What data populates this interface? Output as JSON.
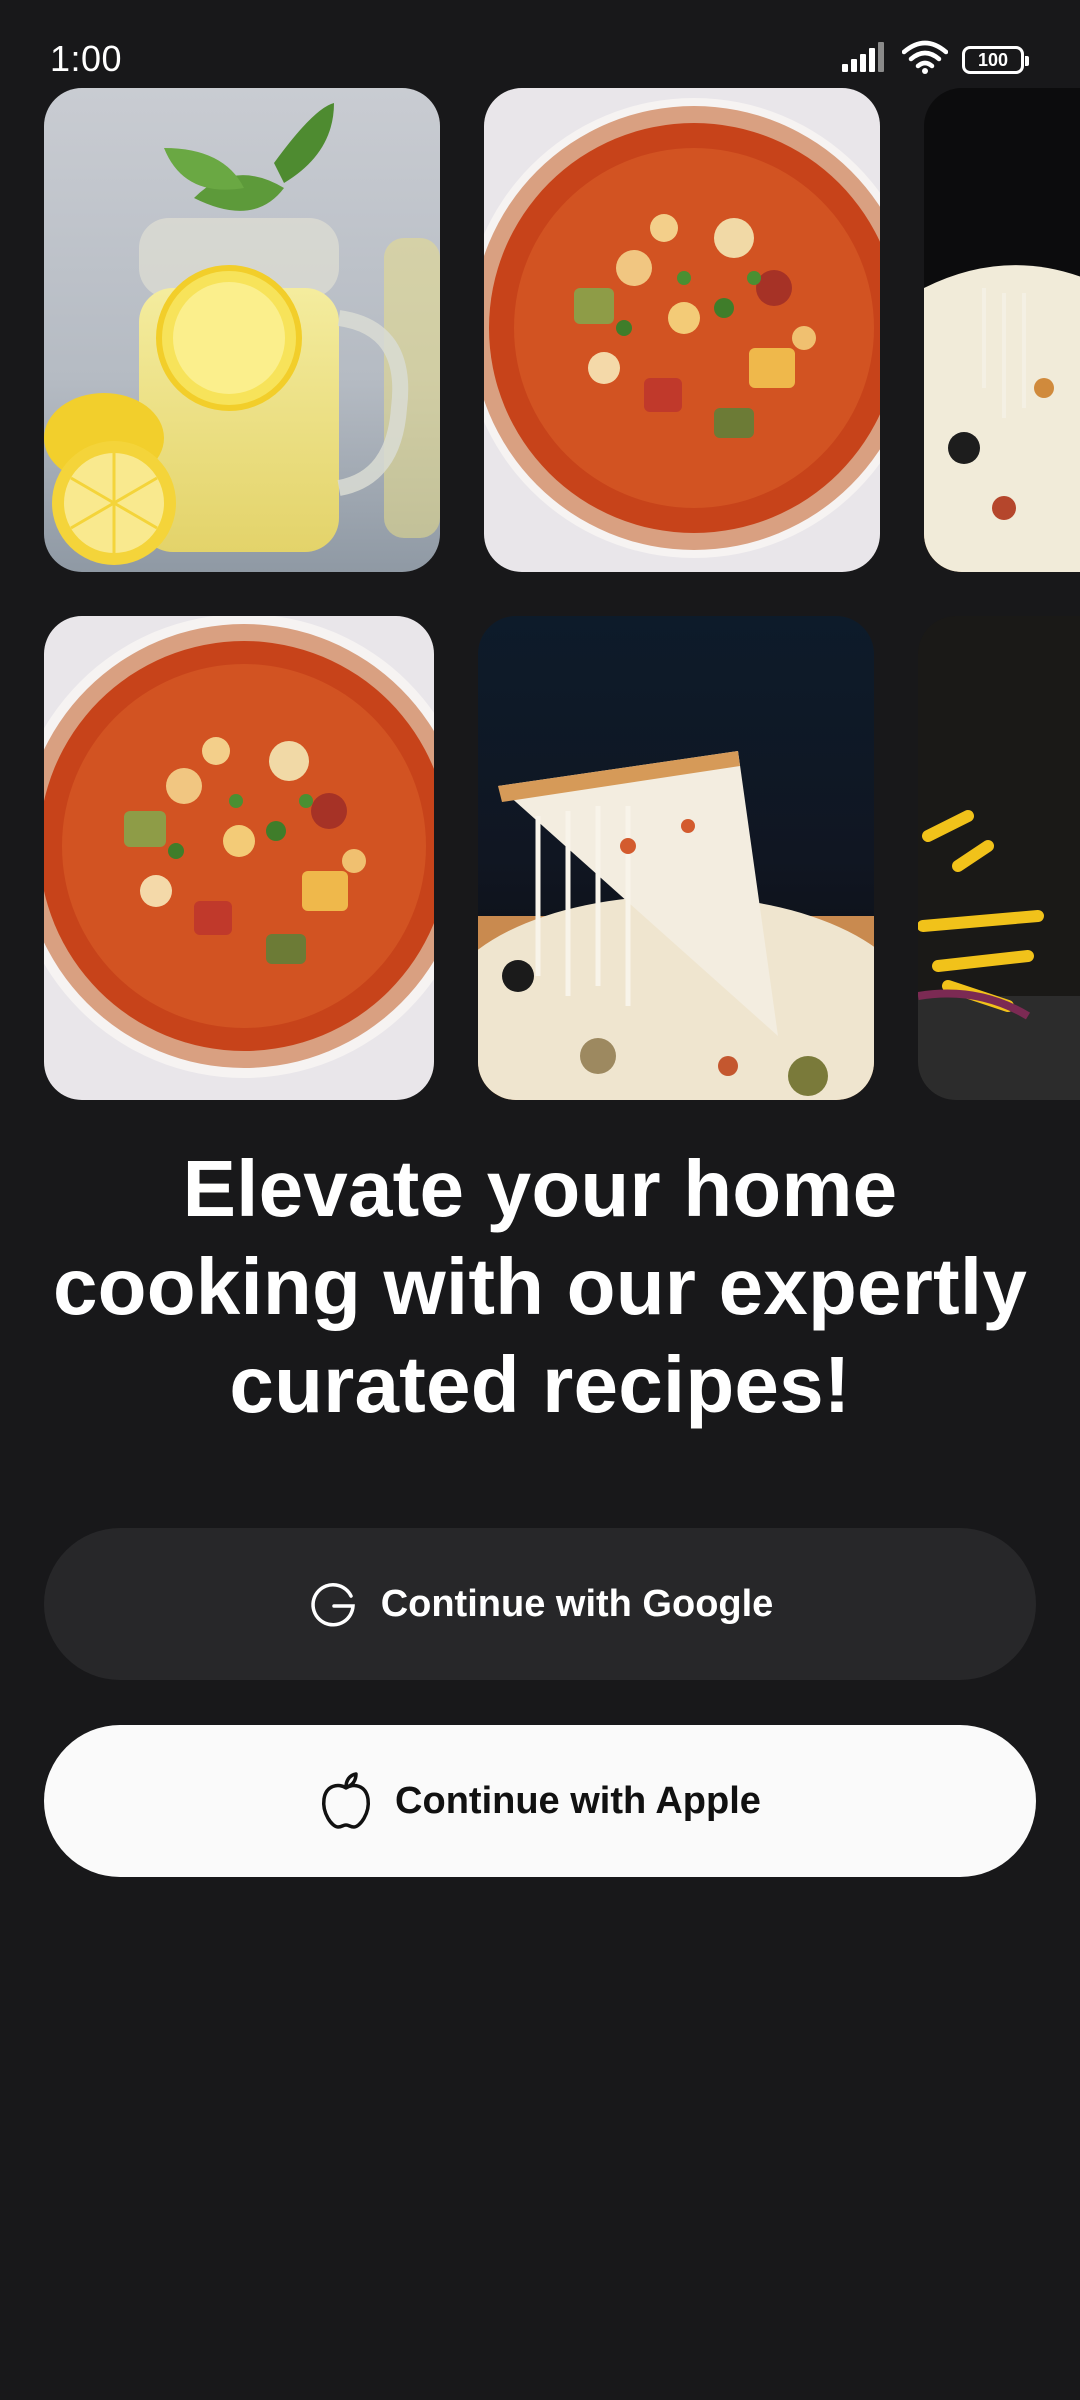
{
  "status_bar": {
    "time": "1:00",
    "battery": "100",
    "icons": [
      "signal-icon",
      "wifi-icon",
      "battery-icon"
    ]
  },
  "gallery": {
    "images": [
      {
        "name": "lemonade-image"
      },
      {
        "name": "minestrone-soup-image"
      },
      {
        "name": "pizza-image"
      },
      {
        "name": "minestrone-soup-image"
      },
      {
        "name": "pizza-slice-image"
      },
      {
        "name": "pasta-image"
      }
    ]
  },
  "headline": "Elevate your home cooking with our expertly curated recipes!",
  "buttons": {
    "google": {
      "label": "Continue with Google",
      "icon": "google-icon"
    },
    "apple": {
      "label": "Continue with Apple",
      "icon": "apple-icon"
    }
  },
  "colors": {
    "background": "#18181a",
    "google_button": "#272729",
    "apple_button": "#fafafa",
    "text_primary": "#ffffff"
  }
}
